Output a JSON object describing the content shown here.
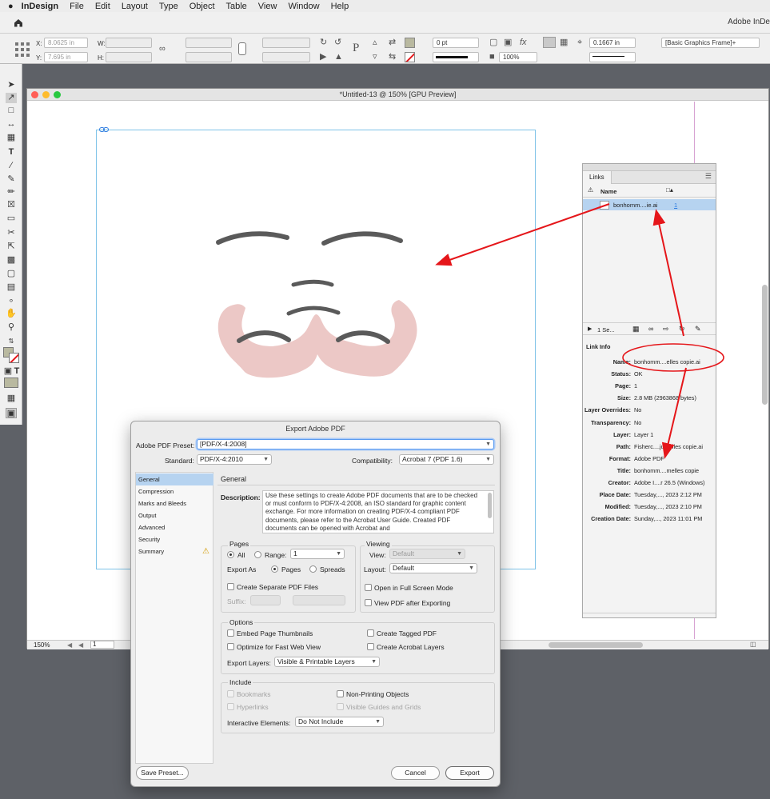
{
  "menubar": {
    "apple": "",
    "app": "InDesign",
    "items": [
      "File",
      "Edit",
      "Layout",
      "Type",
      "Object",
      "Table",
      "View",
      "Window",
      "Help"
    ]
  },
  "apphead": {
    "title": "Adobe InDe"
  },
  "controlbar": {
    "x_label": "X:",
    "x_value": "8.0625 in",
    "y_label": "Y:",
    "y_value": "7.695 in",
    "w_label": "W:",
    "h_label": "H:",
    "stroke_weight": "0 pt",
    "opacity": "100%",
    "corner": "0.1667 in",
    "object_style": "[Basic Graphics Frame]+"
  },
  "document": {
    "title": "*Untitled-13 @ 150% [GPU Preview]",
    "zoom": "150%",
    "page": "1"
  },
  "links_panel": {
    "tab": "Links",
    "col_name": "Name",
    "file_name": "bonhomm....ie.ai",
    "page_ref": "1",
    "selected_count": "1 Se...",
    "info_title": "Link Info",
    "info": [
      {
        "key": "Name:",
        "value": "bonhomm....elles copie.ai"
      },
      {
        "key": "Status:",
        "value": "OK"
      },
      {
        "key": "Page:",
        "value": "1"
      },
      {
        "key": "Size:",
        "value": "2.8 MB (2963868 bytes)"
      },
      {
        "key": "Layer Overrides:",
        "value": "No"
      },
      {
        "key": "Transparency:",
        "value": "No"
      },
      {
        "key": "Layer:",
        "value": "Layer 1"
      },
      {
        "key": "Path:",
        "value": "Fisherc....ju...elles copie.ai"
      },
      {
        "key": "Format:",
        "value": "Adobe PDF"
      },
      {
        "key": "Title:",
        "value": "bonhomm....melles copie"
      },
      {
        "key": "Creator:",
        "value": "Adobe I....r 26.5 (Windows)"
      },
      {
        "key": "Place Date:",
        "value": "Tuesday,..., 2023 2:12 PM"
      },
      {
        "key": "Modified:",
        "value": "Tuesday,..., 2023 2:10 PM"
      },
      {
        "key": "Creation Date:",
        "value": "Sunday,..., 2023 11:01 PM"
      }
    ]
  },
  "dialog": {
    "title": "Export Adobe PDF",
    "preset_label": "Adobe PDF Preset:",
    "preset_value": "[PDF/X-4:2008]",
    "standard_label": "Standard:",
    "standard_value": "PDF/X-4:2010",
    "compat_label": "Compatibility:",
    "compat_value": "Acrobat 7 (PDF 1.6)",
    "nav": [
      "General",
      "Compression",
      "Marks and Bleeds",
      "Output",
      "Advanced",
      "Security",
      "Summary"
    ],
    "section_title": "General",
    "description_label": "Description:",
    "description": "Use these settings to create Adobe PDF documents that are to be checked or must conform to PDF/X-4:2008, an ISO standard for graphic content exchange.  For more information on creating PDF/X-4 compliant PDF documents, please refer to the Acrobat User Guide.  Created PDF documents can be opened with Acrobat and",
    "pages_title": "Pages",
    "all_label": "All",
    "range_label": "Range:",
    "range_value": "1",
    "export_as_label": "Export As",
    "pages_opt": "Pages",
    "spreads_opt": "Spreads",
    "separate_files": "Create Separate PDF Files",
    "suffix_label": "Suffix:",
    "viewing_title": "Viewing",
    "view_label": "View:",
    "view_value": "Default",
    "layout_label": "Layout:",
    "layout_value": "Default",
    "fullscreen": "Open in Full Screen Mode",
    "view_after": "View PDF after Exporting",
    "options_title": "Options",
    "embed_thumbs": "Embed Page Thumbnails",
    "tagged_pdf": "Create Tagged PDF",
    "fast_web": "Optimize for Fast Web View",
    "acrobat_layers": "Create Acrobat Layers",
    "export_layers_label": "Export Layers:",
    "export_layers_value": "Visible & Printable Layers",
    "include_title": "Include",
    "bookmarks": "Bookmarks",
    "nonprinting": "Non-Printing Objects",
    "hyperlinks": "Hyperlinks",
    "visible_guides": "Visible Guides and Grids",
    "interactive_label": "Interactive Elements:",
    "interactive_value": "Do Not Include",
    "save_preset": "Save Preset...",
    "cancel": "Cancel",
    "export": "Export"
  },
  "colors": {
    "accent_blue": "#2f7de1",
    "annotation_red": "#e5161a",
    "frame_blue": "#7fc3e8",
    "face_pink": "#ecc8c6",
    "stroke_gray": "#5a5a5a"
  }
}
